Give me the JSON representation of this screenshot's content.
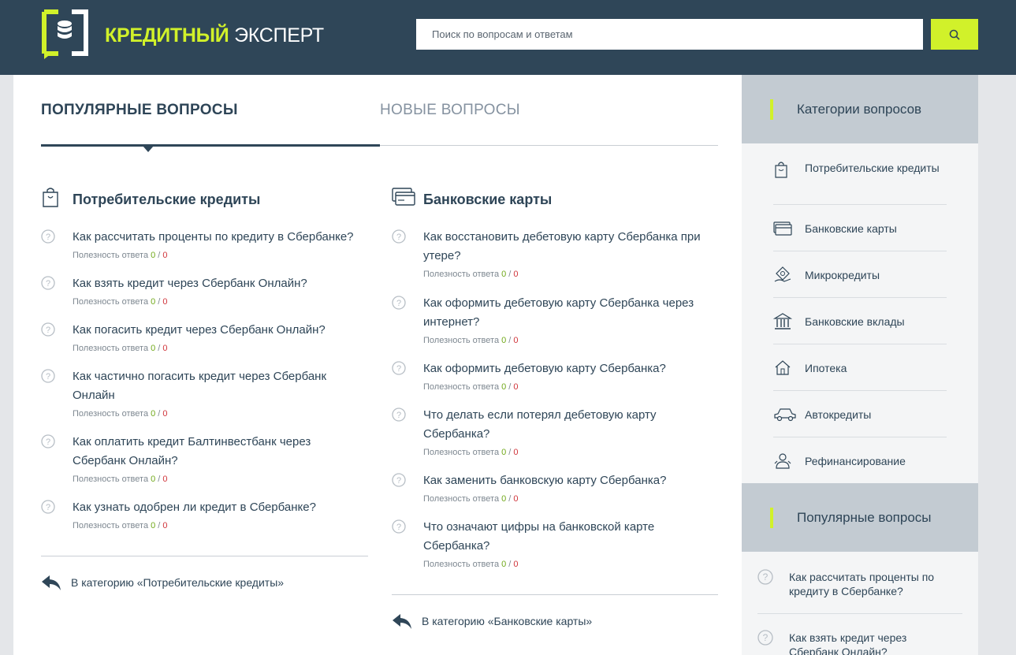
{
  "header": {
    "brand_part1": "КРЕДИТНЫЙ",
    "brand_part2": "ЭКСПЕРТ",
    "search_placeholder": "Поиск по вопросам и ответам",
    "search_icon": "search-icon"
  },
  "tabs": [
    {
      "label": "ПОПУЛЯРНЫЕ ВОПРОСЫ",
      "active": true
    },
    {
      "label": "НОВЫЕ ВОПРОСЫ",
      "active": false
    }
  ],
  "columns": [
    {
      "title": "Потребительские кредиты",
      "icon": "shopping-bag-icon",
      "questions": [
        {
          "text": "Как рассчитать проценты по кредиту в Сбербанке?",
          "meta_label": "Полезность ответа",
          "up": "0",
          "down": "0"
        },
        {
          "text": "Как взять кредит через Сбербанк Онлайн?",
          "meta_label": "Полезность ответа",
          "up": "0",
          "down": "0"
        },
        {
          "text": "Как погасить кредит через Сбербанк Онлайн?",
          "meta_label": "Полезность ответа",
          "up": "0",
          "down": "0"
        },
        {
          "text": "Как частично погасить кредит через Сбербанк Онлайн",
          "meta_label": "Полезность ответа",
          "up": "0",
          "down": "0"
        },
        {
          "text": "Как оплатить кредит Балтинвестбанк через Сбербанк Онлайн?",
          "meta_label": "Полезность ответа",
          "up": "0",
          "down": "0"
        },
        {
          "text": "Как узнать одобрен ли кредит в Сбербанке?",
          "meta_label": "Полезность ответа",
          "up": "0",
          "down": "0"
        }
      ],
      "back_link": "В категорию «Потребительские кредиты»"
    },
    {
      "title": "Банковские карты",
      "icon": "credit-card-icon",
      "questions": [
        {
          "text": "Как восстановить дебетовую карту Сбербанка при утере?",
          "meta_label": "Полезность ответа",
          "up": "0",
          "down": "0"
        },
        {
          "text": "Как оформить дебетовую карту Сбербанка через интернет?",
          "meta_label": "Полезность ответа",
          "up": "0",
          "down": "0"
        },
        {
          "text": "Как оформить дебетовую карту Сбербанка?",
          "meta_label": "Полезность ответа",
          "up": "0",
          "down": "0"
        },
        {
          "text": "Что делать если потерял дебетовую карту Сбербанка?",
          "meta_label": "Полезность ответа",
          "up": "0",
          "down": "0"
        },
        {
          "text": "Как заменить банковскую карту Сбербанка?",
          "meta_label": "Полезность ответа",
          "up": "0",
          "down": "0"
        },
        {
          "text": "Что означают цифры на банковской карте Сбербанка?",
          "meta_label": "Полезность ответа",
          "up": "0",
          "down": "0"
        }
      ],
      "back_link": "В категорию «Банковские карты»"
    }
  ],
  "sidebar": {
    "categories_title": "Категории вопросов",
    "categories": [
      {
        "label": "Потребительские кредиты",
        "icon": "shopping-bag-icon"
      },
      {
        "label": "Банковские карты",
        "icon": "credit-card-icon"
      },
      {
        "label": "Микрокредиты",
        "icon": "money-hand-icon"
      },
      {
        "label": "Банковские вклады",
        "icon": "bank-building-icon"
      },
      {
        "label": "Ипотека",
        "icon": "house-icon"
      },
      {
        "label": "Автокредиты",
        "icon": "car-icon"
      },
      {
        "label": "Рефинансирование",
        "icon": "refinance-person-icon"
      }
    ],
    "popular_title": "Популярные вопросы",
    "popular": [
      {
        "label": "Как рассчитать проценты по кредиту в Сбербанке?"
      },
      {
        "label": "Как взять кредит через Сбербанк Онлайн?"
      }
    ]
  },
  "colors": {
    "header_bg": "#2f4658",
    "accent": "#d1f12a",
    "text": "#2e4557",
    "positive": "#71a91b",
    "negative": "#d0353b"
  }
}
